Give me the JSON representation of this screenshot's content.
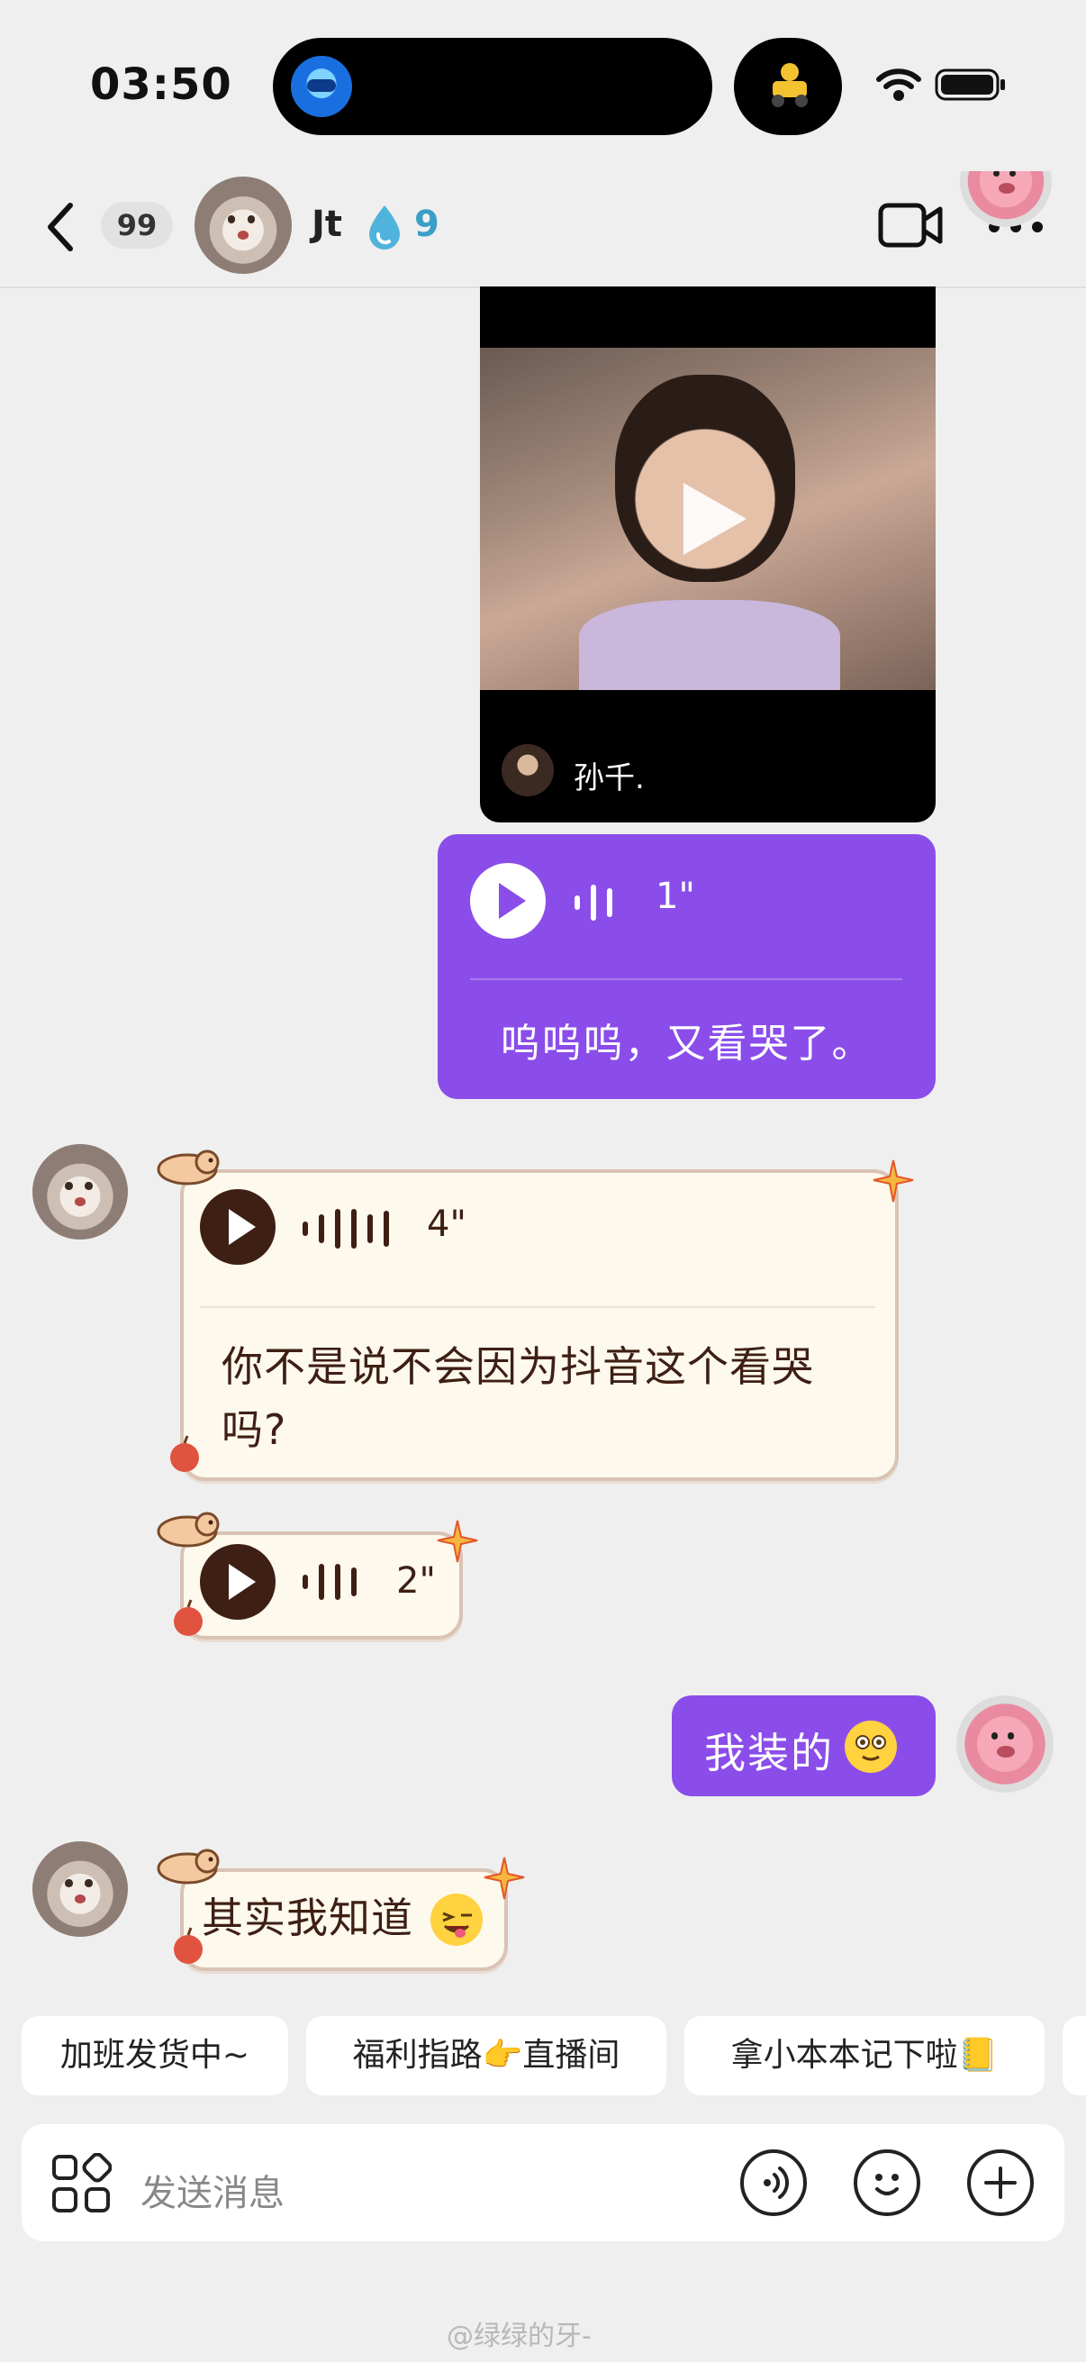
{
  "status_bar": {
    "time": "03:50",
    "island_app_icon": "robot-app-icon",
    "live_activity_icon": "delivery-scooter-icon",
    "wifi_icon": "wifi-icon",
    "battery_icon": "battery-icon"
  },
  "header": {
    "back_icon": "chevron-left-icon",
    "unread_count": "99",
    "contact_name": "Jt",
    "streak_icon": "water-drop-icon",
    "streak_count": "9",
    "video_call_icon": "video-camera-icon",
    "more_icon": "more-horizontal-icon"
  },
  "messages": {
    "video_share": {
      "author": "孙千."
    },
    "voice_mine": {
      "duration": "1\"",
      "transcript": "呜呜呜，又看哭了。"
    },
    "voice_theirs_1": {
      "duration": "4\"",
      "transcript": "你不是说不会因为抖音这个看哭吗?"
    },
    "voice_theirs_2": {
      "duration": "2\""
    },
    "text_mine": {
      "text": "我装的"
    },
    "text_theirs": {
      "text": "其实我知道"
    }
  },
  "quick_replies": [
    {
      "label": "加班发货中~"
    },
    {
      "label": "福利指路👉直播间"
    },
    {
      "label": "拿小本本记下啦📒"
    }
  ],
  "input": {
    "placeholder": "发送消息",
    "apps_icon": "apps-grid-icon",
    "voice_icon": "voice-input-icon",
    "emoji_icon": "emoji-icon",
    "plus_icon": "plus-icon"
  },
  "watermark": "@绿绿的牙-",
  "colors": {
    "background": "#efefef",
    "my_bubble": "#8a4dea",
    "their_bubble": "#fdf9ec",
    "their_text": "#3e1f14",
    "streak": "#3a9fc7"
  }
}
